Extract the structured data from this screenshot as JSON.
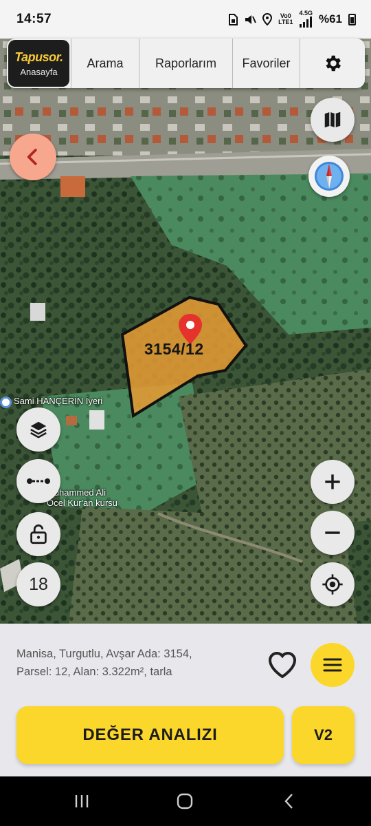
{
  "status_bar": {
    "time": "14:57",
    "network_top": "Vo0",
    "network_bottom": "LTE1",
    "net_type_top": "4.5G",
    "net_type_bottom": "",
    "battery": "%61",
    "icons": [
      "sim-icon",
      "mute-icon",
      "location-icon",
      "signal-icon",
      "battery-icon"
    ]
  },
  "nav": {
    "brand": "Tapusor.",
    "home": "Anasayfa",
    "search": "Arama",
    "reports": "Raporlarım",
    "favorites": "Favoriler",
    "settings_icon": "gear-icon"
  },
  "map": {
    "parcel_label": "3154/12",
    "parcel_fill": "#e39a33",
    "poi_1": "Sami HANÇERİN İyeri",
    "poi_2_line1": "Muhammed Ali",
    "poi_2_line2": "Ocel Kur'an kursu",
    "zoom_level": "18",
    "icons": [
      "back-icon",
      "map-icon",
      "compass-icon",
      "layers-icon",
      "measure-icon",
      "lock-icon",
      "zoom-in-icon",
      "zoom-out-icon",
      "locate-icon"
    ]
  },
  "panel": {
    "info_line1": "Manisa, Turgutlu, Avşar Ada: 3154,",
    "info_line2": "Parsel: 12, Alan: 3.322m², tarla",
    "primary_button": "DEĞER ANALIZI",
    "secondary_button": "V2",
    "accent_color": "#fbd72b"
  },
  "system_nav": {
    "icons": [
      "recent-apps-icon",
      "home-icon",
      "back-icon"
    ]
  }
}
